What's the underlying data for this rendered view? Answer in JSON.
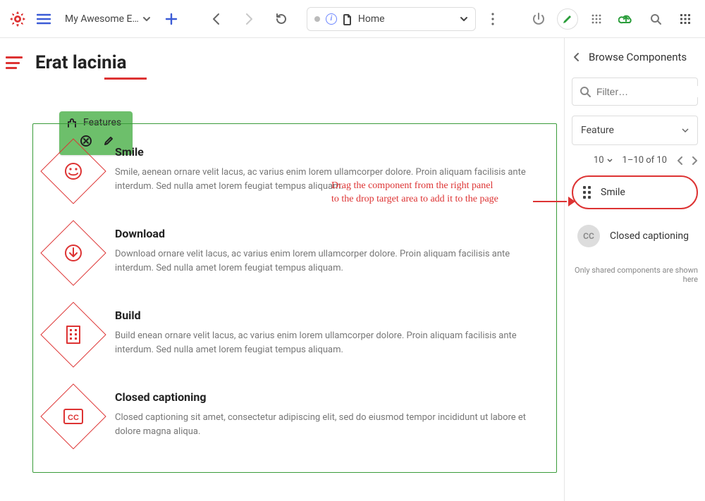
{
  "toolbar": {
    "project_name": "My Awesome E…",
    "breadcrumb_label": "Home"
  },
  "page": {
    "title": "Erat lacinia"
  },
  "features_badge": {
    "label": "Features"
  },
  "features": [
    {
      "title": "Smile",
      "desc": "Smile, aenean ornare velit lacus, ac varius enim lorem ullamcorper dolore. Proin aliquam facilisis ante interdum. Sed nulla amet lorem feugiat tempus aliquam."
    },
    {
      "title": "Download",
      "desc": "Download ornare velit lacus, ac varius enim lorem ullamcorper dolore. Proin aliquam facilisis ante interdum. Sed nulla amet lorem feugiat tempus aliquam."
    },
    {
      "title": "Build",
      "desc": "Build enean ornare velit lacus, ac varius enim lorem ullamcorper dolore. Proin aliquam facilisis ante interdum. Sed nulla amet lorem feugiat tempus aliquam."
    },
    {
      "title": "Closed captioning",
      "desc": "Closed captioning sit amet, consectetur adipiscing elit, sed do eiusmod tempor incididunt ut labore et dolore magna aliqua."
    }
  ],
  "annotation": {
    "line1": "Drag the component from the right panel",
    "line2": "to the drop target area to add it to the page"
  },
  "right": {
    "header": "Browse Components",
    "filter_placeholder": "Filter…",
    "select_label": "Feature",
    "page_size": "10",
    "page_range": "1–10 of 10",
    "items": [
      {
        "label": "Smile"
      },
      {
        "label": "Closed captioning",
        "avatar": "CC"
      }
    ],
    "footer_note": "Only shared components are shown here"
  }
}
